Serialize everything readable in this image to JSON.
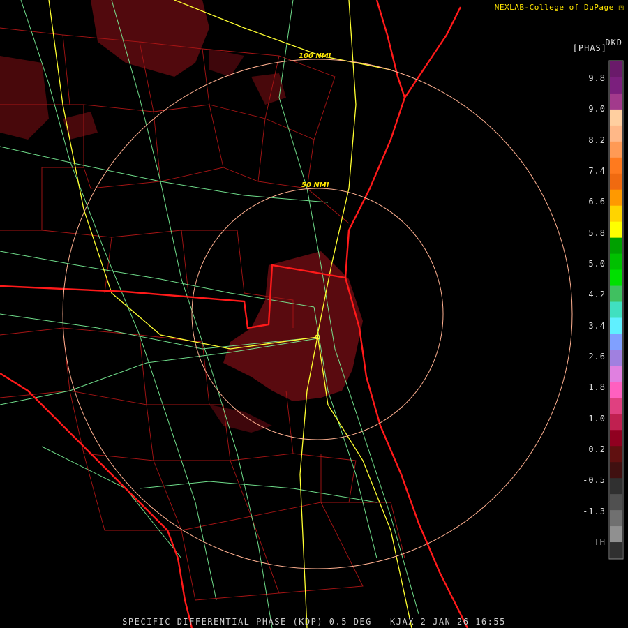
{
  "header": {
    "credit": "NEXLAB-College of DuPage"
  },
  "footer": {
    "caption": "SPECIFIC DIFFERENTIAL PHASE (KDP) 0.5 DEG - KJAX 2 JAN 26 16:55"
  },
  "legend": {
    "title": "DKD",
    "subtitle": "[PHAS]",
    "labels": [
      "9.8",
      "9.0",
      "8.2",
      "7.4",
      "6.6",
      "5.8",
      "5.0",
      "4.2",
      "3.4",
      "2.6",
      "1.8",
      "1.0",
      "0.2",
      "-0.5",
      "-1.3",
      "TH"
    ],
    "colors": [
      "#6a1a6a",
      "#7b1f7d",
      "#a23a8c",
      "#ffcfa0",
      "#ffb888",
      "#ff9a55",
      "#ff7a1e",
      "#f06a10",
      "#ff9900",
      "#ffd400",
      "#ffff00",
      "#00a000",
      "#00c000",
      "#00e000",
      "#40c060",
      "#40e0c0",
      "#60f0ff",
      "#80a0ff",
      "#a080e0",
      "#e080e0",
      "#ff60c0",
      "#e04080",
      "#c02050",
      "#900020",
      "#601010",
      "#401010",
      "#303030",
      "#505050",
      "#707070",
      "#909090",
      "#303030"
    ]
  },
  "rings": [
    {
      "label": "50 NMI"
    },
    {
      "label": "100 NMI"
    }
  ],
  "colors": {
    "state_border": "#ff1a1a",
    "county": "#b01818",
    "highway": "#ffff30",
    "road": "#80ffa0",
    "ring": "#ffb090",
    "echo": "#7a0f14"
  }
}
